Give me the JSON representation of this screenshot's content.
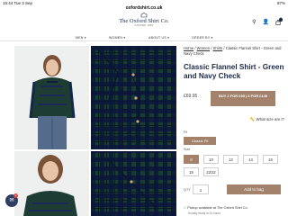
{
  "status_bar": {
    "time": "15:44",
    "day": "Tue 3 Sep",
    "url": "oxfordshirt.co.uk",
    "battery": "87%"
  },
  "brand": {
    "name": "The Oxford Shirt Co.",
    "tagline": "OXFORD 1987"
  },
  "header": {
    "bag_count": "0"
  },
  "nav": {
    "items": [
      "MEN ▾",
      "WOMEN ▾",
      "ABOUT US ▾",
      "ORDER BY ▾"
    ]
  },
  "breadcrumb": {
    "home": "Home",
    "sep": " / ",
    "women": "Women",
    "shirts": "Shirts",
    "current": "Classic Flannel Shirt - Green and Navy Check"
  },
  "product": {
    "title": "Classic Flannel Shirt - Green and Navy Check",
    "price": "£69.95",
    "offer": "BUY 2 FOR £95 | 3 FOR £140",
    "size_fit_link": "What size am I?",
    "fit_label": "Fit",
    "fit_value": "Classic Fit",
    "size_label": "Size",
    "sizes": [
      "8",
      "10",
      "12",
      "14",
      "16",
      "18",
      "22/22"
    ],
    "selected_size": "8",
    "qty_label": "QTY",
    "qty_value": "1",
    "add_to_bag": "Add to bag",
    "pickup": "Pickup available at The Oxford Shirt Co.",
    "ready": "Usually ready in 24 hours"
  },
  "chat": {
    "badge": "1"
  },
  "colors": {
    "accent": "#a2826b",
    "brand_navy": "#1b2a4a"
  }
}
